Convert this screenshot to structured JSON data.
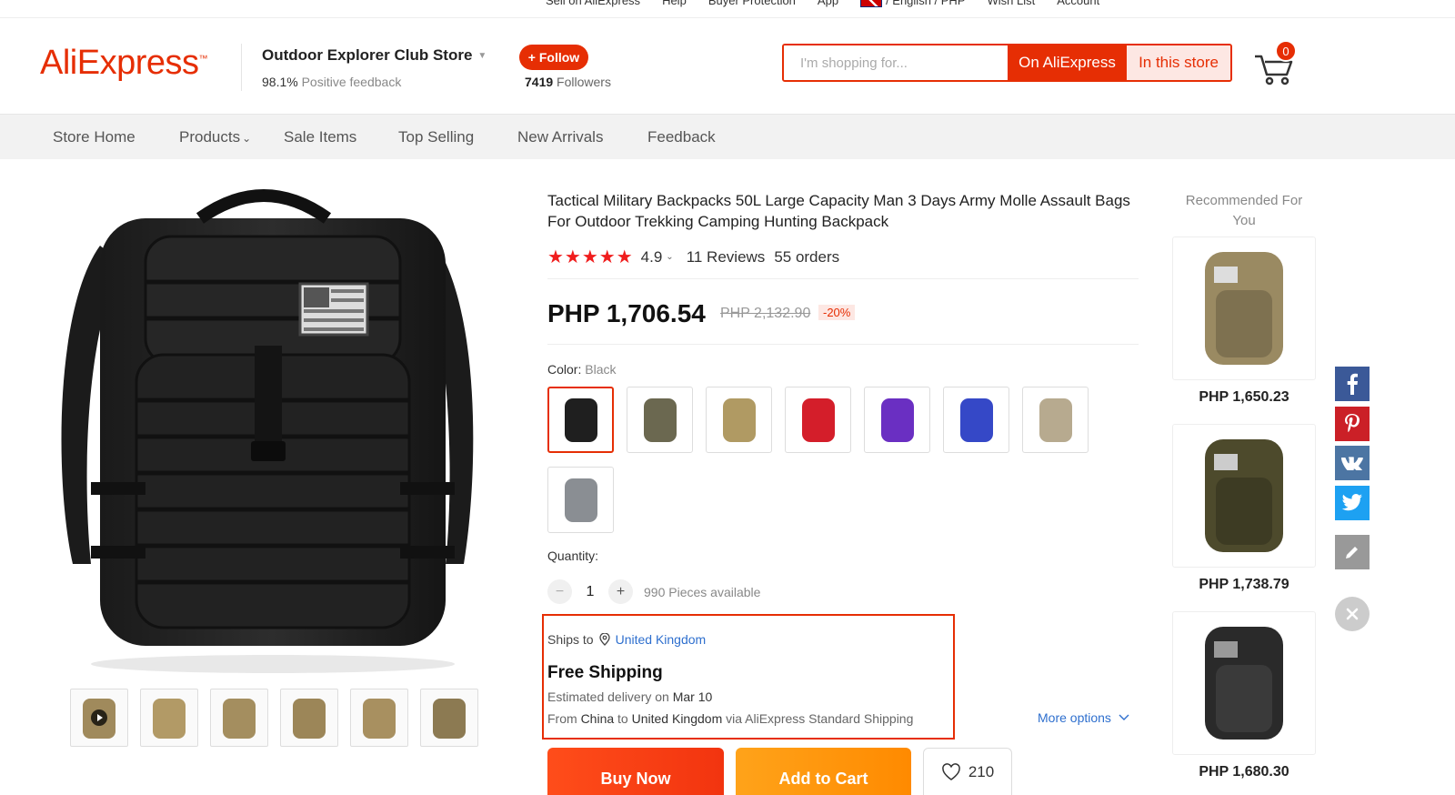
{
  "top_links": {
    "sell": "Sell on AliExpress",
    "help": "Help",
    "buyer_protection": "Buyer Protection",
    "app": "App",
    "language": "/ English / PHP",
    "wishlist": "Wish List",
    "account": "Account"
  },
  "header": {
    "logo": "AliExpress",
    "store_name": "Outdoor Explorer Club Store",
    "feedback_pct": "98.1%",
    "feedback_label": "Positive feedback",
    "follow_label": "+ Follow",
    "followers_count": "7419",
    "followers_label": "Followers",
    "search_placeholder": "I'm shopping for...",
    "search_ali_label": "On AliExpress",
    "search_store_label": "In this store",
    "cart_count": "0"
  },
  "nav": {
    "items": [
      "Store Home",
      "Products",
      "Sale Items",
      "Top Selling",
      "New Arrivals",
      "Feedback"
    ]
  },
  "product": {
    "title": "Tactical Military Backpacks 50L Large Capacity Man 3 Days Army Molle Assault Bags For Outdoor Trekking Camping Hunting Backpack",
    "stars": "★★★★★",
    "rating": "4.9",
    "reviews": "11 Reviews",
    "orders": "55 orders",
    "price": "PHP 1,706.54",
    "old_price": "PHP 2,132.90",
    "discount": "-20%",
    "color_label": "Color:",
    "color_value": "Black",
    "swatch_colors": [
      "#1f1f1f",
      "#6b6850",
      "#b09a63",
      "#d41e2a",
      "#6a2fc2",
      "#3548c7",
      "#b7aa8f",
      "#8a8e93"
    ],
    "quantity_label": "Quantity:",
    "quantity": "1",
    "available": "990 Pieces available",
    "ships_to_label": "Ships to",
    "ships_to_country": "United Kingdom",
    "free_shipping": "Free Shipping",
    "est_label": "Estimated delivery on",
    "est_date": "Mar 10",
    "from_label": "From",
    "from_country": "China",
    "to_label": "to",
    "to_country": "United Kingdom",
    "via_text": "via AliExpress Standard Shipping",
    "more_options": "More options",
    "buy_now": "Buy Now",
    "add_to_cart": "Add to Cart",
    "wish_count": "210"
  },
  "gallery": {
    "thumb_colors": [
      "#a08a5c",
      "#b29a66",
      "#a48e5f",
      "#9c8658",
      "#a89060",
      "#8c7a52"
    ]
  },
  "recommended": {
    "title": "Recommended For You",
    "items": [
      {
        "price": "PHP 1,650.23",
        "color": "#9a8a62"
      },
      {
        "price": "PHP 1,738.79",
        "color": "#4d4a2c"
      },
      {
        "price": "PHP 1,680.30",
        "color": "#2a2a2a"
      }
    ]
  },
  "share": {
    "facebook_color": "#3b5998",
    "pinterest_color": "#cb2027",
    "vk_color": "#4c75a3",
    "twitter_color": "#1da1f2",
    "edit_color": "#999999"
  },
  "colors": {
    "accent": "#e62e04",
    "link": "#2e6fce"
  }
}
